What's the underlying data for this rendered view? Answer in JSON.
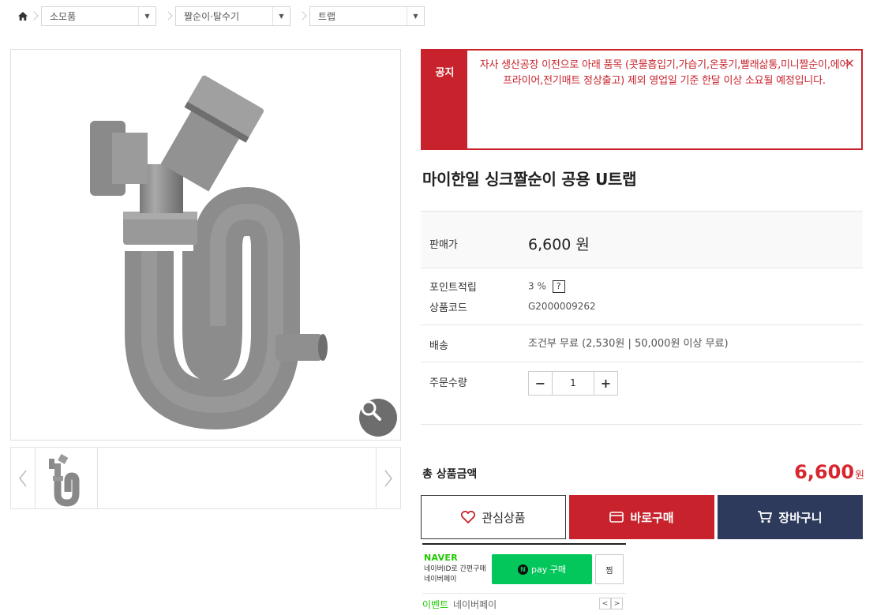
{
  "breadcrumb": {
    "items": [
      {
        "label": "소모품"
      },
      {
        "label": "짤순이·탈수기"
      },
      {
        "label": "트랩"
      }
    ]
  },
  "notice": {
    "label": "공지",
    "text": "자사 생산공장 이전으로 아래 품목 (콧물흡입기,가습기,온풍기,빨래삶통,미니짤순이,에어프라이어,전기매트 정상출고) 제외 영업일 기준 한달 이상 소요될 예정입니다.",
    "close": "×"
  },
  "product": {
    "title": "마이한일 싱크짤순이 공용 U트랩",
    "price_label": "판매가",
    "price": "6,600 원",
    "point_label": "포인트적립",
    "point_value": "3 %",
    "point_help": "?",
    "code_label": "상품코드",
    "code_value": "G2000009262",
    "shipping_label": "배송",
    "shipping_value": "조건부 무료 (2,530원 | 50,000원 이상 무료)",
    "qty_label": "주문수량",
    "qty_minus": "−",
    "qty_value": "1",
    "qty_plus": "+"
  },
  "total": {
    "label": "총 상품금액",
    "amount": "6,600",
    "unit": "원"
  },
  "buttons": {
    "wish": "관심상품",
    "buy": "바로구매",
    "cart": "장바구니"
  },
  "naverpay": {
    "brand": "NAVER",
    "sub1": "네이버ID로 간편구매",
    "sub2": "네이버페이",
    "pay_label": "pay 구매",
    "n_mark": "N",
    "zzim": "찜",
    "event_label": "이벤트",
    "event_text": "네이버페이",
    "prev": "<",
    "next": ">"
  },
  "colors": {
    "accent_red": "#c8232c",
    "navy": "#2d3a5c",
    "naver_green": "#03c75a"
  }
}
